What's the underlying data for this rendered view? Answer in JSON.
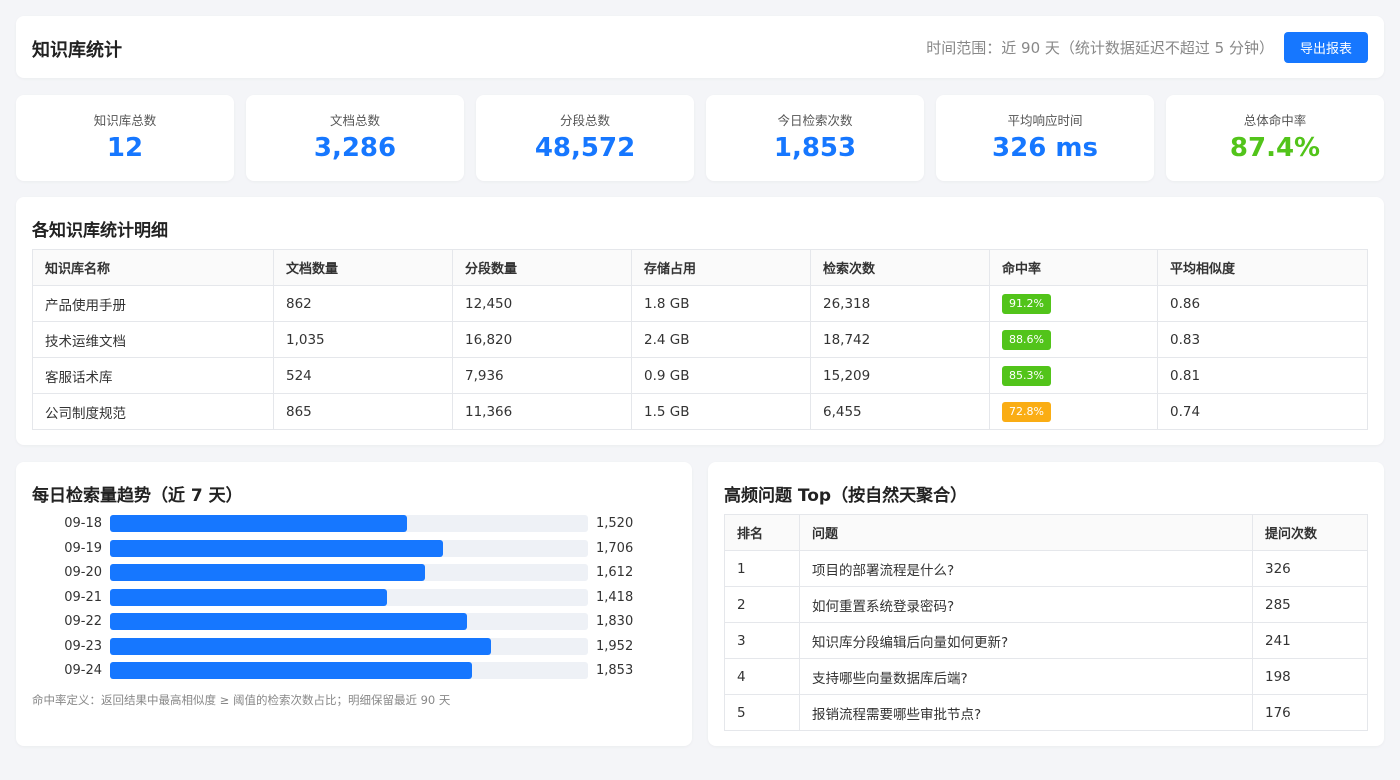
{
  "header": {
    "title": "知识库统计",
    "range": "时间范围：近 90 天（统计数据延迟不超过 5 分钟）",
    "export_label": "导出报表"
  },
  "stats": [
    {
      "label": "知识库总数",
      "value": "12"
    },
    {
      "label": "文档总数",
      "value": "3,286"
    },
    {
      "label": "分段总数",
      "value": "48,572"
    },
    {
      "label": "今日检索次数",
      "value": "1,853"
    },
    {
      "label": "平均响应时间",
      "value": "326 ms"
    },
    {
      "label": "总体命中率",
      "value": "87.4%"
    }
  ],
  "detail": {
    "title": "各知识库统计明细",
    "columns": [
      "知识库名称",
      "文档数量",
      "分段数量",
      "存储占用",
      "检索次数",
      "命中率",
      "平均相似度"
    ],
    "rows": [
      {
        "name": "产品使用手册",
        "docs": "862",
        "segments": "12,450",
        "storage": "1.8 GB",
        "searches": "26,318",
        "hit": "91.2%",
        "hit_color": "#52c41a",
        "sim": "0.86"
      },
      {
        "name": "技术运维文档",
        "docs": "1,035",
        "segments": "16,820",
        "storage": "2.4 GB",
        "searches": "18,742",
        "hit": "88.6%",
        "hit_color": "#52c41a",
        "sim": "0.83"
      },
      {
        "name": "客服话术库",
        "docs": "524",
        "segments": "7,936",
        "storage": "0.9 GB",
        "searches": "15,209",
        "hit": "85.3%",
        "hit_color": "#52c41a",
        "sim": "0.81"
      },
      {
        "name": "公司制度规范",
        "docs": "865",
        "segments": "11,366",
        "storage": "1.5 GB",
        "searches": "6,455",
        "hit": "72.8%",
        "hit_color": "#faad14",
        "sim": "0.74"
      }
    ]
  },
  "trend": {
    "title": "每日检索量趋势（近 7 天）",
    "footnote": "命中率定义：返回结果中最高相似度 ≥ 阈值的检索次数占比；明细保留最近 90 天"
  },
  "chart_data": {
    "type": "bar",
    "categories": [
      "09-18",
      "09-19",
      "09-20",
      "09-21",
      "09-22",
      "09-23",
      "09-24"
    ],
    "values": [
      1520,
      1706,
      1612,
      1418,
      1830,
      1952,
      1853
    ],
    "value_labels": [
      "1,520",
      "1,706",
      "1,612",
      "1,418",
      "1,830",
      "1,952",
      "1,853"
    ],
    "orientation": "horizontal",
    "xlim": [
      0,
      2450
    ],
    "bar_color": "#1677ff",
    "track_color": "#eef1f6"
  },
  "top_questions": {
    "title": "高频问题 Top（按自然天聚合）",
    "columns": [
      "排名",
      "问题",
      "提问次数"
    ],
    "rows": [
      {
        "rank": "1",
        "question": "项目的部署流程是什么?",
        "count": "326"
      },
      {
        "rank": "2",
        "question": "如何重置系统登录密码?",
        "count": "285"
      },
      {
        "rank": "3",
        "question": "知识库分段编辑后向量如何更新?",
        "count": "241"
      },
      {
        "rank": "4",
        "question": "支持哪些向量数据库后端?",
        "count": "198"
      },
      {
        "rank": "5",
        "question": "报销流程需要哪些审批节点?",
        "count": "176"
      }
    ]
  }
}
